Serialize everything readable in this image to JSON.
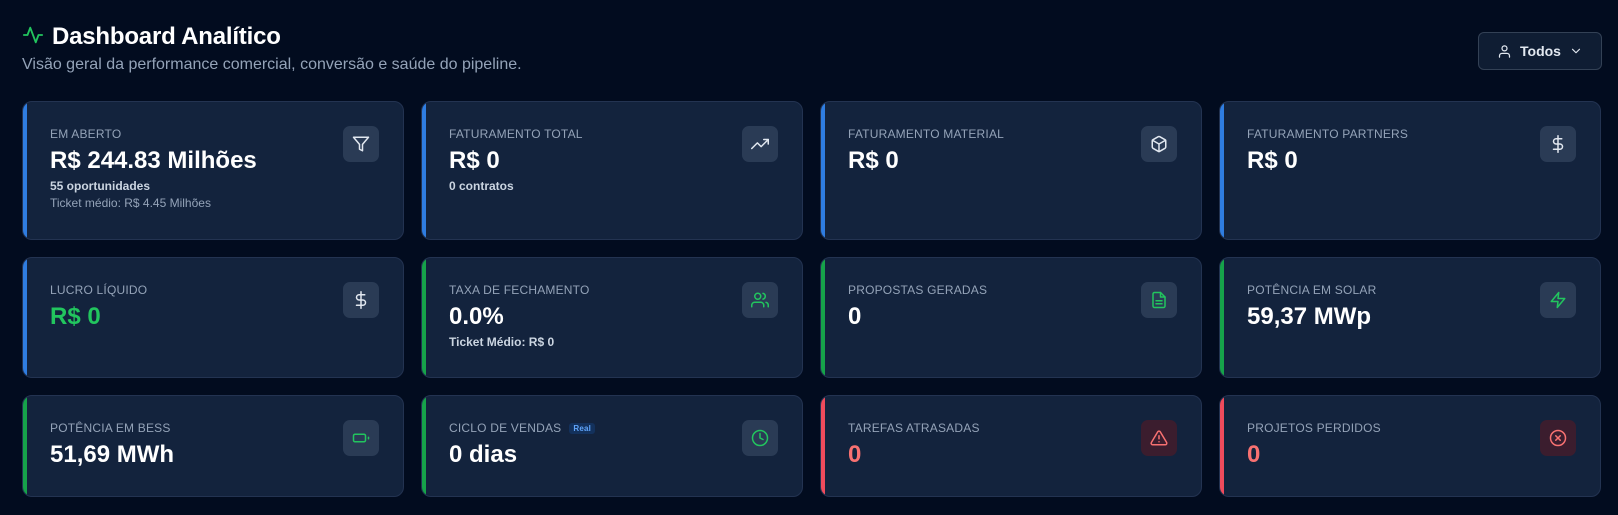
{
  "header": {
    "title": "Dashboard Analítico",
    "subtitle": "Visão geral da performance comercial, conversão e saúde do pipeline.",
    "filter_label": "Todos"
  },
  "colors": {
    "blue": "#2f7de1",
    "green": "#16a34a",
    "red": "#ef4b5c",
    "lime": "#22c55e"
  },
  "cards": [
    {
      "label": "EM ABERTO",
      "value": "R$ 244.83 Milhões",
      "sub": "55 oportunidades",
      "sub2": "Ticket médio: R$ 4.45 Milhões",
      "icon": "funnel-icon"
    },
    {
      "label": "FATURAMENTO TOTAL",
      "value": "R$ 0",
      "sub": "0 contratos",
      "icon": "trending-up-icon"
    },
    {
      "label": "FATURAMENTO MATERIAL",
      "value": "R$ 0",
      "icon": "package-icon"
    },
    {
      "label": "FATURAMENTO PARTNERS",
      "value": "R$ 0",
      "icon": "dollar-icon"
    },
    {
      "label": "LUCRO LÍQUIDO",
      "value": "R$ 0",
      "icon": "dollar-icon"
    },
    {
      "label": "TAXA DE FECHAMENTO",
      "value": "0.0%",
      "sub": "Ticket Médio: R$ 0",
      "icon": "users-icon"
    },
    {
      "label": "PROPOSTAS GERADAS",
      "value": "0",
      "icon": "file-text-icon"
    },
    {
      "label": "POTÊNCIA EM SOLAR",
      "value": "59,37 MWp",
      "icon": "zap-icon"
    },
    {
      "label": "POTÊNCIA EM BESS",
      "value": "51,69 MWh",
      "icon": "battery-icon"
    },
    {
      "label": "CICLO DE VENDAS",
      "badge": "Real",
      "value": "0 dias",
      "icon": "clock-icon"
    },
    {
      "label": "TAREFAS ATRASADAS",
      "value": "0",
      "icon": "alert-triangle-icon"
    },
    {
      "label": "PROJETOS PERDIDOS",
      "value": "0",
      "icon": "x-circle-icon"
    }
  ]
}
